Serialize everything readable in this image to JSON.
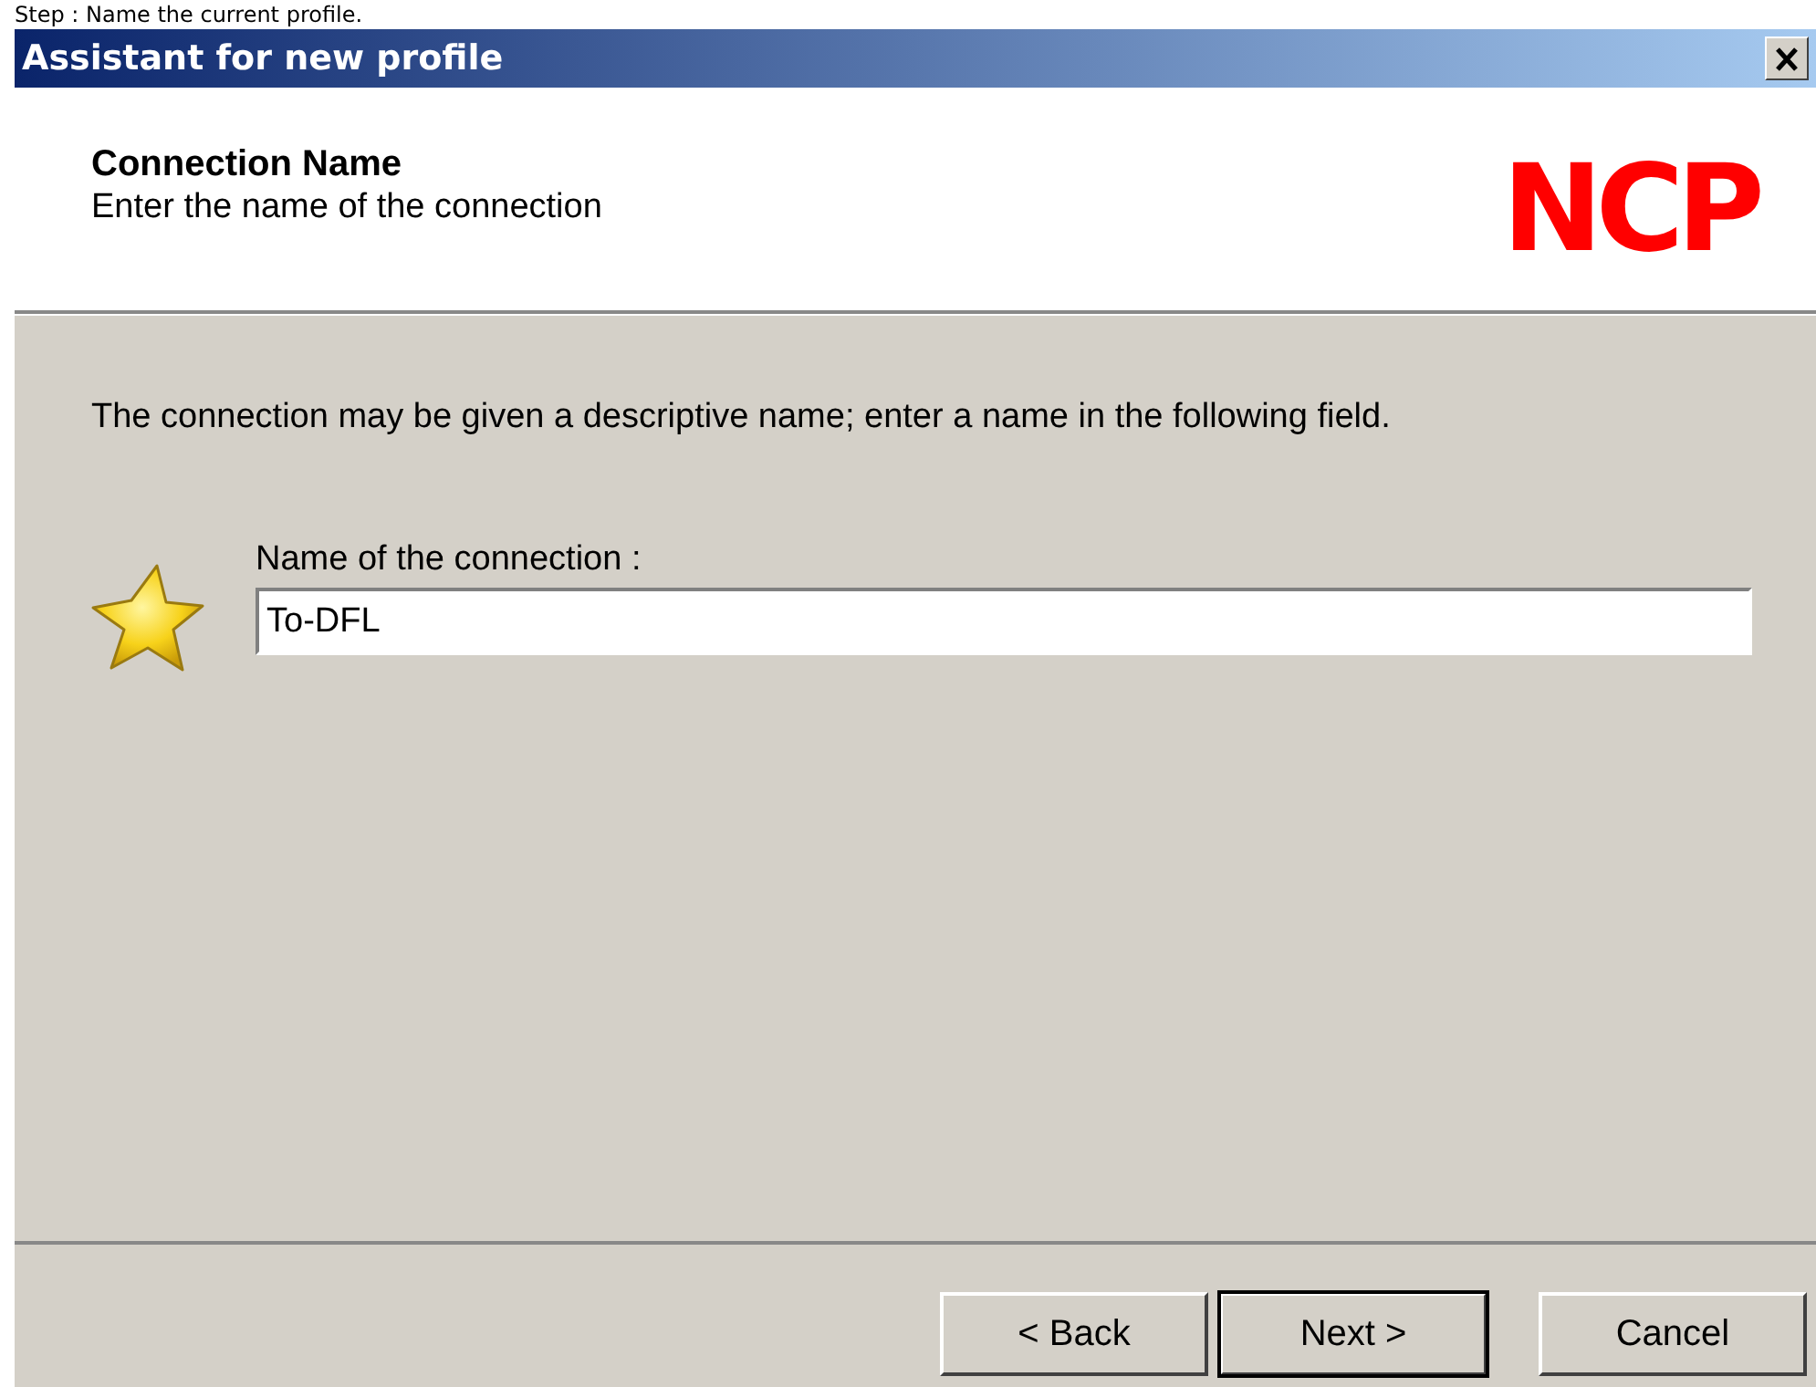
{
  "caption": "Step : Name the current profile.",
  "window": {
    "title": "Assistant for new profile"
  },
  "header": {
    "title": "Connection Name",
    "subtitle": "Enter the name of the connection",
    "logo": "NCP"
  },
  "description": "The connection may be given a descriptive name; enter a name in the following field.",
  "field": {
    "label": "Name of the connection :",
    "value": "To-DFL"
  },
  "buttons": [
    {
      "label": "< Back",
      "default": false
    },
    {
      "label": "Next >",
      "default": true
    },
    {
      "label": "Cancel",
      "default": false
    }
  ]
}
